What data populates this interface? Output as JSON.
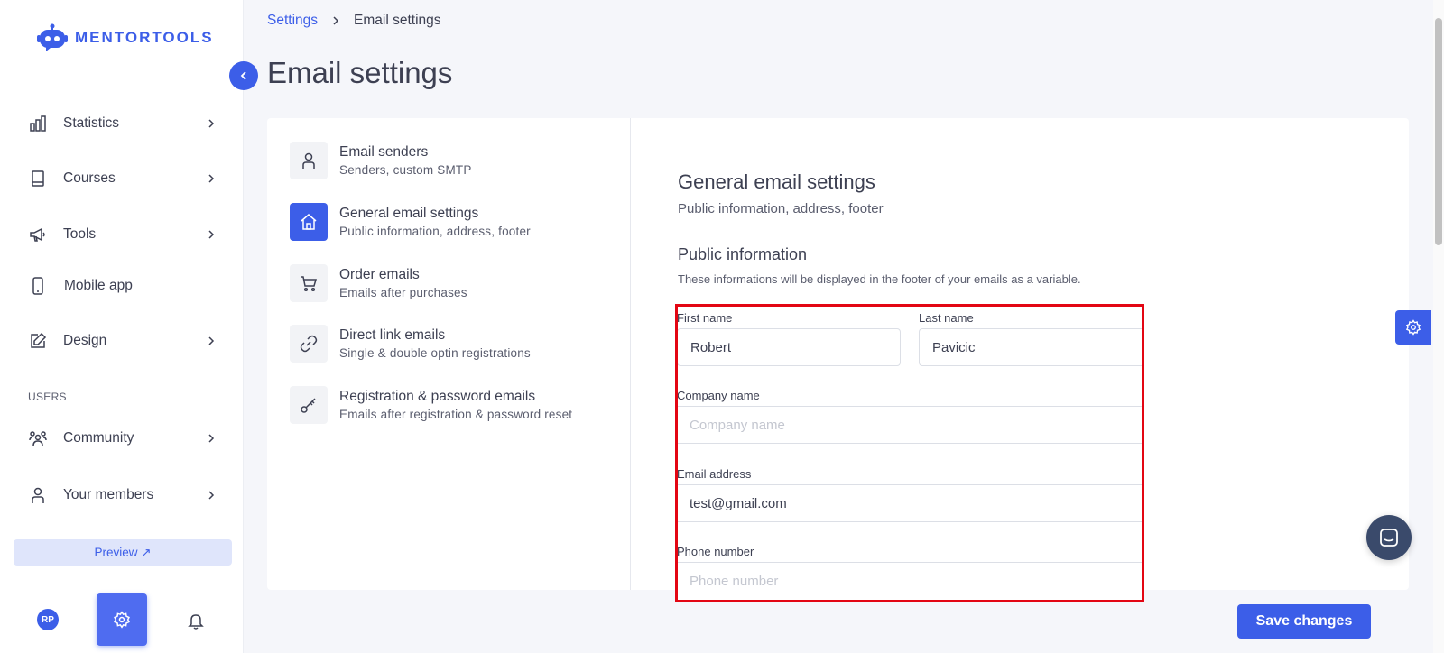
{
  "brand": {
    "name": "MENTORTOOLS",
    "accent": "#3c5ee8",
    "highlight": "#e30613"
  },
  "sidebar": {
    "items": [
      {
        "label": "Statistics",
        "icon": "bar-chart-icon"
      },
      {
        "label": "Courses",
        "icon": "book-icon"
      },
      {
        "label": "Tools",
        "icon": "megaphone-icon"
      },
      {
        "label": "Mobile app",
        "icon": "mobile-icon"
      },
      {
        "label": "Design",
        "icon": "edit-icon"
      },
      {
        "label": "Community",
        "icon": "community-icon"
      },
      {
        "label": "Your members",
        "icon": "user-icon"
      }
    ],
    "section_users": "USERS",
    "preview_label": "Preview ↗",
    "avatar_initials": "RP"
  },
  "breadcrumb": {
    "parent": "Settings",
    "current": "Email settings"
  },
  "page_title": "Email settings",
  "settings_menu": [
    {
      "title": "Email senders",
      "subtitle": "Senders, custom SMTP",
      "icon": "person-icon"
    },
    {
      "title": "General email settings",
      "subtitle": "Public information, address, footer",
      "icon": "home-icon",
      "active": true
    },
    {
      "title": "Order emails",
      "subtitle": "Emails after purchases",
      "icon": "cart-icon"
    },
    {
      "title": "Direct link emails",
      "subtitle": "Single & double optin registrations",
      "icon": "link-icon"
    },
    {
      "title": "Registration & password emails",
      "subtitle": "Emails after registration & password reset",
      "icon": "key-icon"
    }
  ],
  "content": {
    "title": "General email settings",
    "subtitle": "Public information, address, footer",
    "section_title": "Public information",
    "section_desc": "These informations will be displayed in the footer of your emails as a variable.",
    "fields": {
      "first_name": {
        "label": "First name",
        "value": "Robert"
      },
      "last_name": {
        "label": "Last name",
        "value": "Pavicic"
      },
      "company": {
        "label": "Company name",
        "value": "",
        "placeholder": "Company name"
      },
      "email": {
        "label": "Email address",
        "value": "test@gmail.com"
      },
      "phone": {
        "label": "Phone number",
        "value": "",
        "placeholder": "Phone number"
      }
    }
  },
  "save_label": "Save changes"
}
